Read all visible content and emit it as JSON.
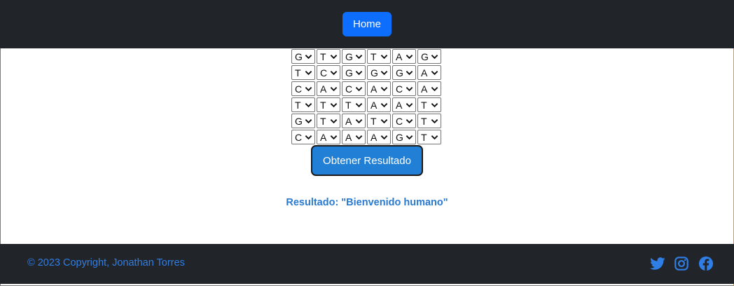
{
  "nav": {
    "home_label": "Home"
  },
  "dna_grid": {
    "rows": [
      [
        "G",
        "T",
        "G",
        "T",
        "A",
        "G"
      ],
      [
        "T",
        "C",
        "G",
        "G",
        "G",
        "A"
      ],
      [
        "C",
        "A",
        "C",
        "A",
        "C",
        "A"
      ],
      [
        "T",
        "T",
        "T",
        "A",
        "A",
        "T"
      ],
      [
        "G",
        "T",
        "A",
        "T",
        "C",
        "T"
      ],
      [
        "C",
        "A",
        "A",
        "A",
        "G",
        "T"
      ]
    ]
  },
  "actions": {
    "submit_label": "Obtener Resultado"
  },
  "result": {
    "text": "Resultado: \"Bienvenido humano\""
  },
  "footer": {
    "copyright": "© 2023 Copyright, Jonathan Torres",
    "social": [
      "twitter-icon",
      "instagram-icon",
      "facebook-icon"
    ]
  },
  "colors": {
    "navbar_bg": "#212529",
    "primary": "#0d6efd",
    "submit_bg": "#2180d6",
    "result_text": "#2a7ad0",
    "footer_link": "#2f7ee6"
  }
}
